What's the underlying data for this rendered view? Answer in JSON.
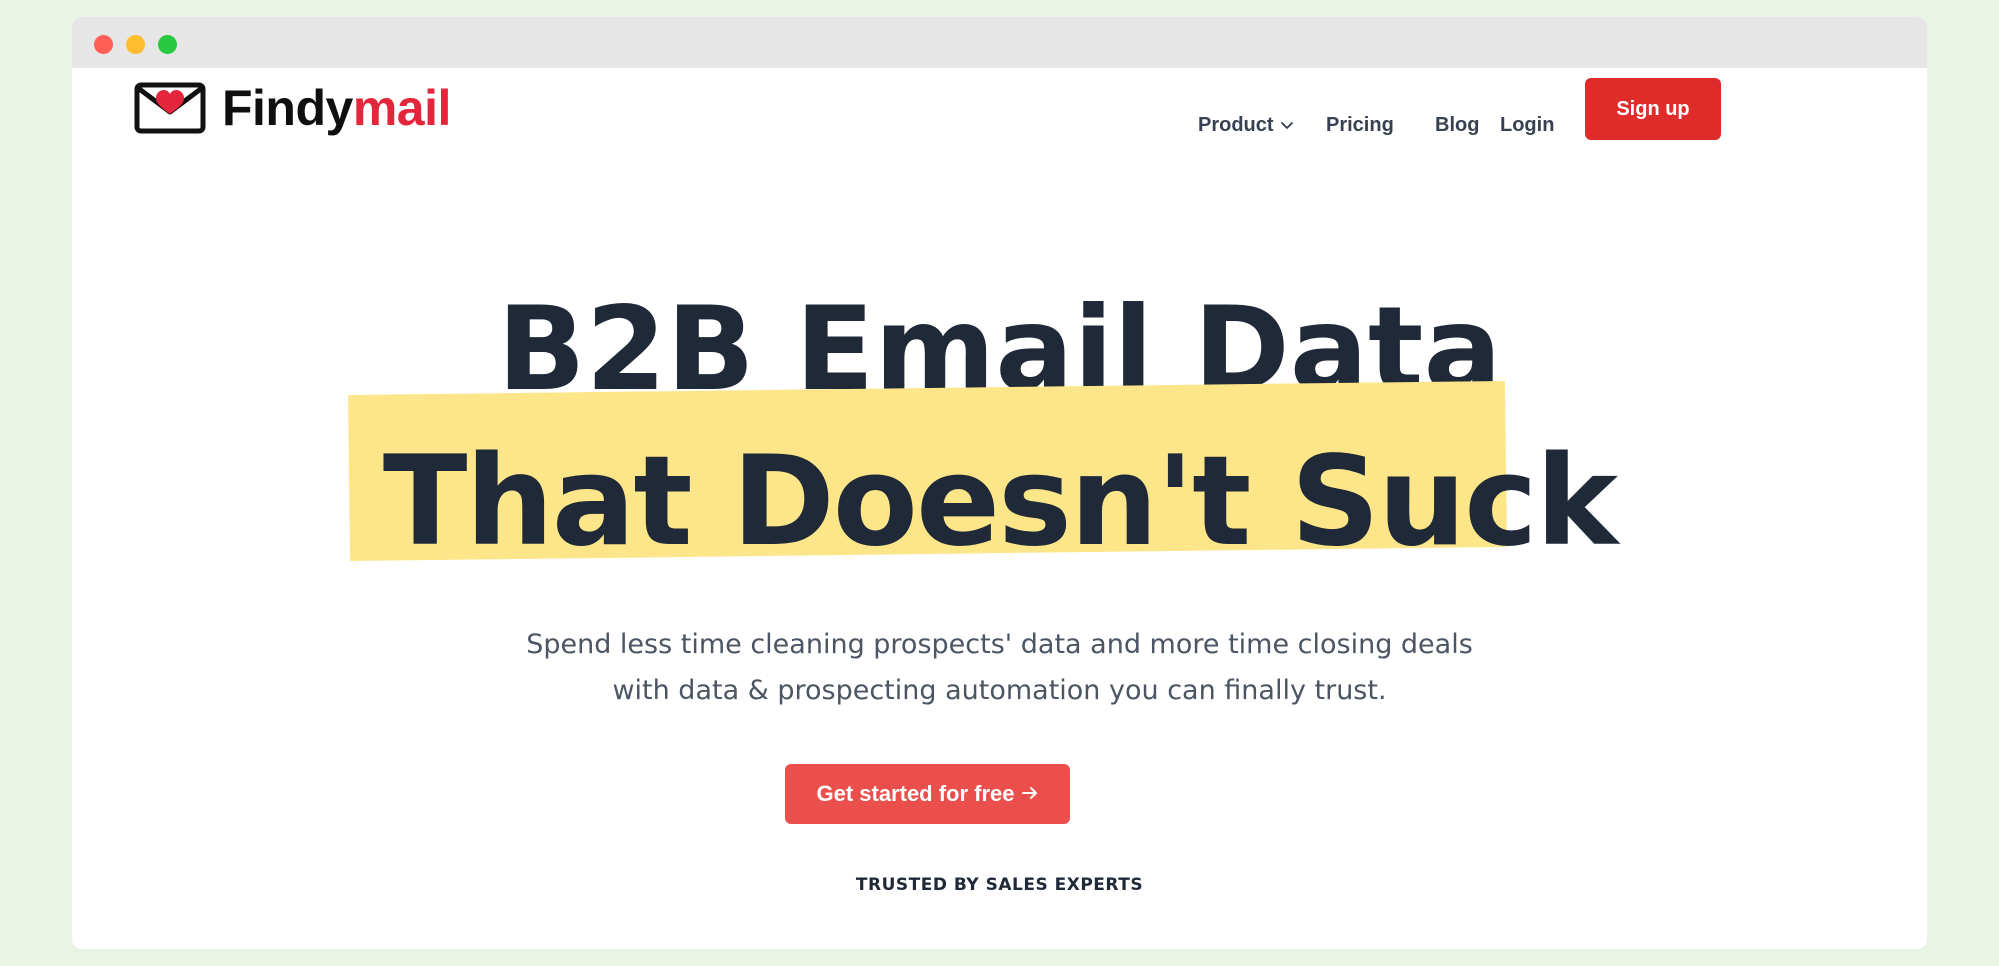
{
  "window": {
    "controls": [
      "close",
      "minimize",
      "maximize"
    ]
  },
  "brand": {
    "name_part1": "Findy",
    "name_part2": "mail",
    "icon": "envelope-heart-icon",
    "accent_color": "#e3263b"
  },
  "nav": {
    "product_label": "Product",
    "pricing_label": "Pricing",
    "blog_label": "Blog",
    "login_label": "Login",
    "signup_label": "Sign up",
    "signup_color": "#e02b2b"
  },
  "hero": {
    "headline_line1": "B2B Email Data",
    "headline_line2": "That Doesn't Suck",
    "highlight_color": "#fde68a",
    "subtitle_line1": "Spend less time cleaning prospects' data and more time closing deals",
    "subtitle_line2": "with data & prospecting automation you can finally trust.",
    "cta_label": "Get started for free",
    "cta_icon": "arrow-right-icon",
    "cta_color": "#ea4f4c",
    "trusted_label": "TRUSTED BY SALES EXPERTS"
  }
}
